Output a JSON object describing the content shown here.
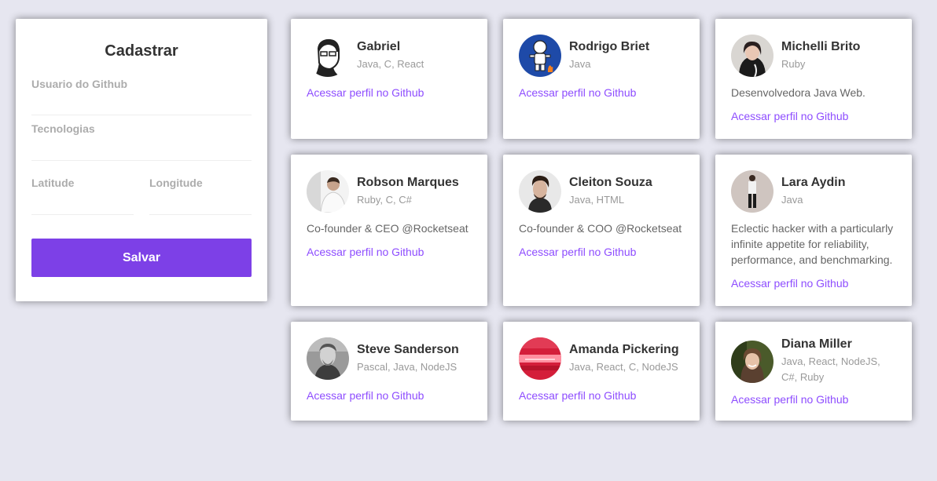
{
  "form": {
    "title": "Cadastrar",
    "github_label": "Usuario do Github",
    "github_value": "",
    "techs_label": "Tecnologias",
    "techs_value": "",
    "latitude_label": "Latitude",
    "latitude_value": "",
    "longitude_label": "Longitude",
    "longitude_value": "",
    "save_label": "Salvar"
  },
  "colors": {
    "background": "#e6e6f0",
    "accent": "#7d40e7",
    "link": "#8e4dff"
  },
  "devs": [
    {
      "name": "Gabriel",
      "techs": "Java, C, React",
      "bio": "",
      "link": "Acessar perfil no Github",
      "avatar": "cartoon-avatar"
    },
    {
      "name": "Rodrigo Briet",
      "techs": "Java",
      "bio": "",
      "link": "Acessar perfil no Github",
      "avatar": "blue-mascot-avatar"
    },
    {
      "name": "Michelli Brito",
      "techs": "Ruby",
      "bio": "Desenvolvedora Java Web.",
      "link": "Acessar perfil no Github",
      "avatar": "photo-avatar"
    },
    {
      "name": "Robson Marques",
      "techs": "Ruby, C, C#",
      "bio": "Co-founder & CEO @Rocketseat",
      "link": "Acessar perfil no Github",
      "avatar": "photo-avatar"
    },
    {
      "name": "Cleiton Souza",
      "techs": "Java, HTML",
      "bio": "Co-founder & COO @Rocketseat",
      "link": "Acessar perfil no Github",
      "avatar": "photo-avatar"
    },
    {
      "name": "Lara Aydin",
      "techs": "Java",
      "bio": "Eclectic hacker with a particularly infinite appetite for reliability, performance, and benchmarking.",
      "link": "Acessar perfil no Github",
      "avatar": "photo-avatar"
    },
    {
      "name": "Steve Sanderson",
      "techs": "Pascal, Java, NodeJS",
      "bio": "",
      "link": "Acessar perfil no Github",
      "avatar": "photo-avatar"
    },
    {
      "name": "Amanda Pickering",
      "techs": "Java, React, C, NodeJS",
      "bio": "",
      "link": "Acessar perfil no Github",
      "avatar": "red-photo-avatar"
    },
    {
      "name": "Diana Miller",
      "techs": "Java, React, NodeJS, C#, Ruby",
      "bio": "",
      "link": "Acessar perfil no Github",
      "avatar": "photo-avatar"
    }
  ]
}
